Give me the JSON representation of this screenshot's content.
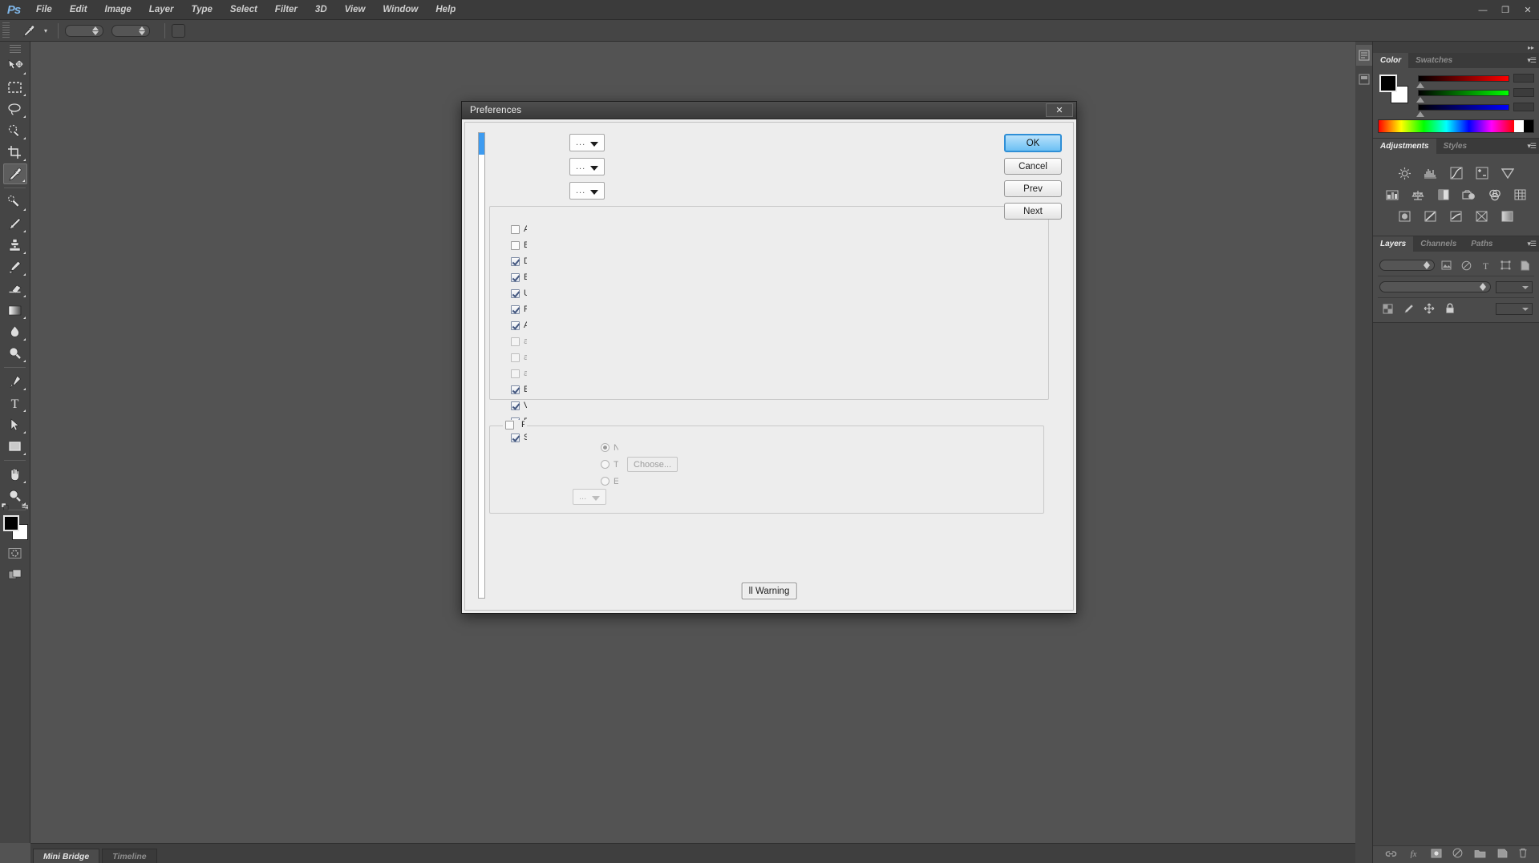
{
  "app": {
    "name": "Photoshop",
    "logo_text": "Ps"
  },
  "menubar": {
    "items": [
      {
        "label": "File"
      },
      {
        "label": "Edit"
      },
      {
        "label": "Image"
      },
      {
        "label": "Layer"
      },
      {
        "label": "Type"
      },
      {
        "label": "Select"
      },
      {
        "label": "Filter"
      },
      {
        "label": "3D"
      },
      {
        "label": "View"
      },
      {
        "label": "Window"
      },
      {
        "label": "Help"
      }
    ],
    "window_controls": [
      {
        "name": "minimize",
        "glyph": "—"
      },
      {
        "name": "maximize",
        "glyph": "❐"
      },
      {
        "name": "close",
        "glyph": "✕"
      }
    ]
  },
  "options_bar": {
    "active_tool": "eyedropper-tool",
    "preset_caret": "▾",
    "sample_size_value": "",
    "sample_layer_value": "",
    "swatch_label": ""
  },
  "toolbar": {
    "tools": [
      {
        "name": "move-tool",
        "has_flyout": true,
        "active": false
      },
      {
        "name": "rectangular-marquee-tool",
        "has_flyout": true,
        "active": false
      },
      {
        "name": "lasso-tool",
        "has_flyout": true,
        "active": false
      },
      {
        "name": "quick-selection-tool",
        "has_flyout": true,
        "active": false
      },
      {
        "name": "crop-tool",
        "has_flyout": true,
        "active": false
      },
      {
        "name": "eyedropper-tool",
        "has_flyout": true,
        "active": true
      },
      {
        "name": "spot-healing-brush-tool",
        "has_flyout": true,
        "active": false
      },
      {
        "name": "brush-tool",
        "has_flyout": true,
        "active": false
      },
      {
        "name": "clone-stamp-tool",
        "has_flyout": true,
        "active": false
      },
      {
        "name": "history-brush-tool",
        "has_flyout": true,
        "active": false
      },
      {
        "name": "eraser-tool",
        "has_flyout": true,
        "active": false
      },
      {
        "name": "gradient-tool",
        "has_flyout": true,
        "active": false
      },
      {
        "name": "blur-tool",
        "has_flyout": true,
        "active": false
      },
      {
        "name": "dodge-tool",
        "has_flyout": true,
        "active": false
      },
      {
        "name": "pen-tool",
        "has_flyout": true,
        "active": false
      },
      {
        "name": "horizontal-type-tool",
        "has_flyout": true,
        "active": false
      },
      {
        "name": "path-selection-tool",
        "has_flyout": true,
        "active": false
      },
      {
        "name": "rectangle-tool",
        "has_flyout": true,
        "active": false
      },
      {
        "name": "hand-tool",
        "has_flyout": true,
        "active": false
      },
      {
        "name": "zoom-tool",
        "has_flyout": true,
        "active": false
      }
    ],
    "foreground_color": "#000000",
    "background_color": "#ffffff",
    "quick_mask_name": "quick-mask-toggle",
    "screen_mode_name": "screen-mode-toggle"
  },
  "statusbar": {
    "tabs": [
      {
        "label": "Mini Bridge",
        "active": true
      },
      {
        "label": "Timeline",
        "active": false
      }
    ]
  },
  "dock": {
    "color_panel": {
      "tabs": [
        {
          "label": "Color",
          "active": true
        },
        {
          "label": "Swatches",
          "active": false
        }
      ],
      "foreground_color": "#000000",
      "background_color": "#ffffff",
      "sliders": [
        {
          "channel": "R",
          "value": ""
        },
        {
          "channel": "G",
          "value": ""
        },
        {
          "channel": "B",
          "value": ""
        }
      ]
    },
    "adjustments_panel": {
      "tabs": [
        {
          "label": "Adjustments",
          "active": true
        },
        {
          "label": "Styles",
          "active": false
        }
      ],
      "icons": [
        [
          "brightness-contrast-icon",
          "levels-icon",
          "curves-icon",
          "exposure-icon",
          "vibrance-icon"
        ],
        [
          "hue-saturation-icon",
          "color-balance-icon",
          "black-white-icon",
          "photo-filter-icon",
          "channel-mixer-icon",
          "color-lookup-icon"
        ],
        [
          "invert-icon",
          "posterize-icon",
          "threshold-icon",
          "gradient-map-icon",
          "selective-color-icon"
        ]
      ]
    },
    "layers_panel": {
      "tabs": [
        {
          "label": "Layers",
          "active": true
        },
        {
          "label": "Channels",
          "active": false
        },
        {
          "label": "Paths",
          "active": false
        }
      ],
      "filter_icons": [
        "filter-kind-icon",
        "pixel-filter-icon",
        "adjustment-filter-icon",
        "type-filter-icon",
        "shape-filter-icon",
        "smart-object-filter-icon"
      ],
      "blend_mode_value": "",
      "opacity_label": "",
      "opacity_value": "",
      "lock_icons": [
        "lock-transparency-icon",
        "lock-image-icon",
        "lock-position-icon",
        "lock-all-icon"
      ],
      "fill_value": "",
      "footer_icons": [
        "link-layers-icon",
        "layer-style-fx-icon",
        "add-layer-mask-icon",
        "new-adjustment-layer-icon",
        "new-group-icon",
        "new-layer-icon",
        "delete-layer-icon"
      ]
    }
  },
  "dialog": {
    "title": "Preferences",
    "close_glyph": "✕",
    "category_list": {
      "name": "preferences-category-list",
      "selected_index": 0
    },
    "dropdowns": [
      {
        "name": "image-previews-dropdown",
        "value": "...",
        "disabled": false
      },
      {
        "name": "icon-dropdown",
        "value": "...",
        "disabled": false
      },
      {
        "name": "append-file-extension-dropdown",
        "value": "...",
        "disabled": false
      }
    ],
    "file_compatibility_group": {
      "name": "file-compatibility-group",
      "legend": "",
      "checkboxes": [
        {
          "label": "A",
          "checked": false,
          "disabled": false
        },
        {
          "label": "B",
          "checked": false,
          "disabled": false
        },
        {
          "label": "D",
          "checked": true,
          "disabled": false
        },
        {
          "label": "E",
          "checked": true,
          "disabled": false
        },
        {
          "label": "U",
          "checked": true,
          "disabled": false
        },
        {
          "label": "P",
          "checked": true,
          "disabled": false
        },
        {
          "label": "A",
          "checked": true,
          "disabled": false
        },
        {
          "label": "a",
          "checked": false,
          "disabled": true
        },
        {
          "label": "a",
          "checked": false,
          "disabled": true
        },
        {
          "label": "a",
          "checked": false,
          "disabled": true
        },
        {
          "label": "E",
          "checked": true,
          "disabled": false
        },
        {
          "label": "V",
          "checked": true,
          "disabled": false
        },
        {
          "label": "P",
          "checked": true,
          "disabled": false
        },
        {
          "label": "S",
          "checked": true,
          "disabled": false
        }
      ]
    },
    "adobe_drive_group": {
      "name": "adobe-drive-group",
      "legend_checkbox": {
        "label": "F",
        "checked": false,
        "disabled": false
      },
      "radios": [
        {
          "label": "N",
          "selected": true,
          "disabled": true
        },
        {
          "label": "T",
          "selected": false,
          "disabled": true
        },
        {
          "label": "E",
          "selected": false,
          "disabled": true
        }
      ],
      "choose_button": "Choose...",
      "dropdown": {
        "name": "drive-dropdown",
        "value": "...",
        "disabled": true
      }
    },
    "reset_warnings_button": "ll Warning",
    "buttons": [
      {
        "label": "OK",
        "primary": true,
        "name": "ok-button"
      },
      {
        "label": "Cancel",
        "primary": false,
        "name": "cancel-button"
      },
      {
        "label": "Prev",
        "primary": false,
        "name": "prev-button"
      },
      {
        "label": "Next",
        "primary": false,
        "name": "next-button"
      }
    ]
  },
  "colors": {
    "accent": "#3d9bf0",
    "chrome": "#454545",
    "canvas": "#535353",
    "dialog_bg": "#ededed"
  }
}
